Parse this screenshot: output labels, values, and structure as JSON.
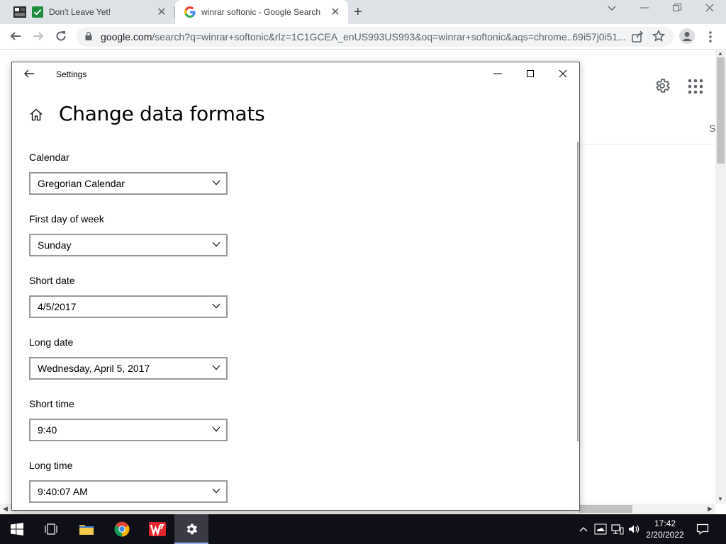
{
  "browser": {
    "tabs": [
      {
        "title": "Don't Leave Yet!",
        "icon": "check-box-icon"
      },
      {
        "title": "winrar softonic - Google Search",
        "icon": "google-g-icon",
        "active": true
      }
    ],
    "url_domain": "google.com",
    "url_path": "/search?q=winrar+softonic&rlz=1C1GCEA_enUS993US993&oq=winrar+softonic&aqs=chrome..69i57j0i51...",
    "partial_text": "S"
  },
  "settings": {
    "window_title": "Settings",
    "heading": "Change data formats",
    "fields": [
      {
        "label": "Calendar",
        "value": "Gregorian Calendar"
      },
      {
        "label": "First day of week",
        "value": "Sunday"
      },
      {
        "label": "Short date",
        "value": "4/5/2017"
      },
      {
        "label": "Long date",
        "value": "Wednesday, April 5, 2017"
      },
      {
        "label": "Short time",
        "value": "9:40"
      },
      {
        "label": "Long time",
        "value": "9:40:07 AM"
      }
    ]
  },
  "taskbar": {
    "apps": [
      "windows-start-icon",
      "task-view-icon",
      "file-explorer-icon",
      "chrome-icon",
      "wps-office-icon",
      "settings-gear-icon"
    ],
    "clock_time": "17:42",
    "clock_date": "2/20/2022"
  },
  "colors": {
    "taskbar_bg": "#0f0f17",
    "tabstrip_bg": "#dee1e6",
    "combo_border": "#999999"
  }
}
